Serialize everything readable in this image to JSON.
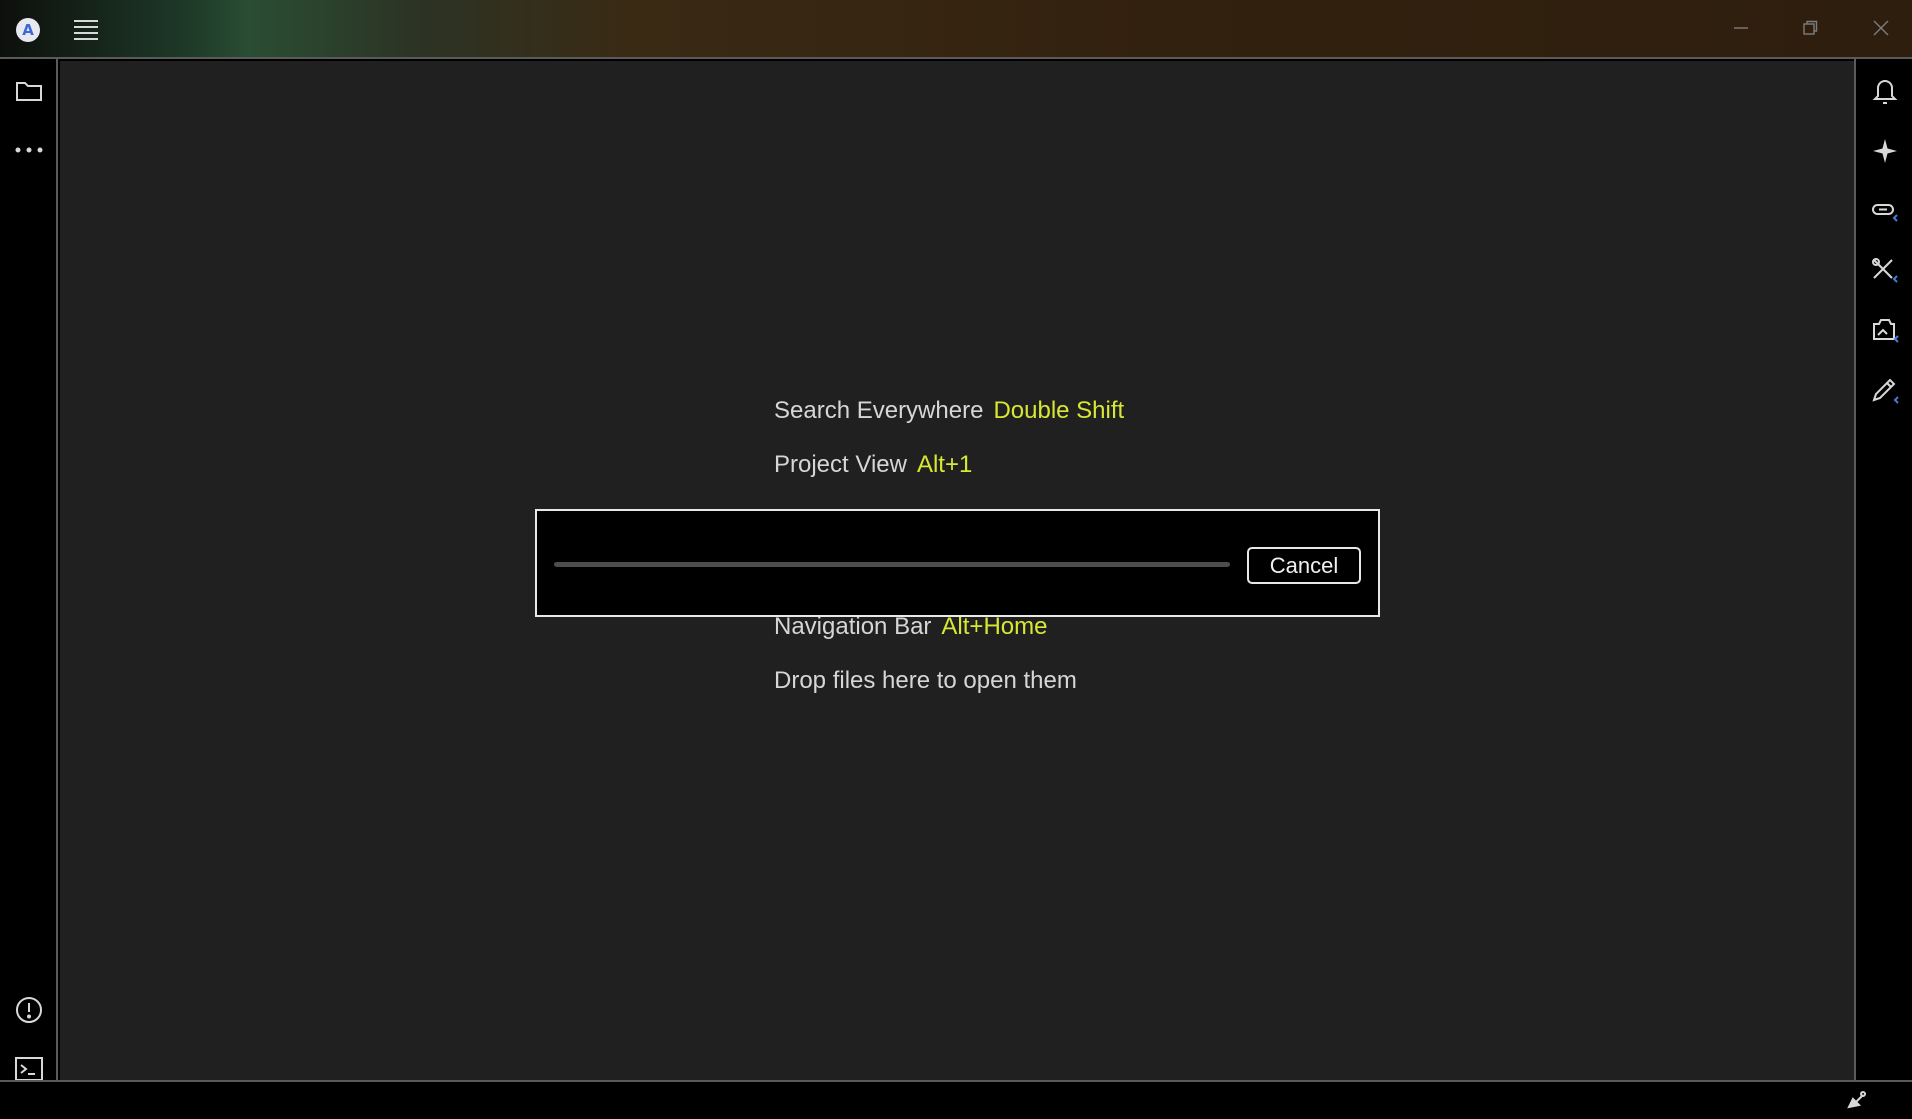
{
  "titlebar": {
    "logo_letter": "A",
    "menu_icon": "hamburger-menu-icon",
    "window_controls": [
      "minimize-icon",
      "restore-icon",
      "close-icon"
    ]
  },
  "left_toolbar": {
    "top_icons": [
      "folder-icon",
      "more-horizontal-icon"
    ],
    "bottom_icons": [
      "problems-icon",
      "terminal-icon"
    ]
  },
  "right_toolbar": {
    "icons": [
      "bell-icon",
      "sparkle-icon",
      "link-plugin-icon",
      "tools-plugin-icon",
      "image-plugin-icon",
      "pencil-plugin-icon"
    ]
  },
  "hints": [
    {
      "label": "Search Everywhere",
      "key": "Double Shift"
    },
    {
      "label": "Project View",
      "key": "Alt+1"
    },
    {
      "label": "Navigation Bar",
      "key": "Alt+Home"
    },
    {
      "label": "Drop files here to open them",
      "key": ""
    }
  ],
  "progress_dialog": {
    "cancel_label": "Cancel"
  },
  "statusbar": {
    "icon": "satellite-icon"
  },
  "colors": {
    "accent_key": "#d8e832",
    "background": "#202020"
  }
}
